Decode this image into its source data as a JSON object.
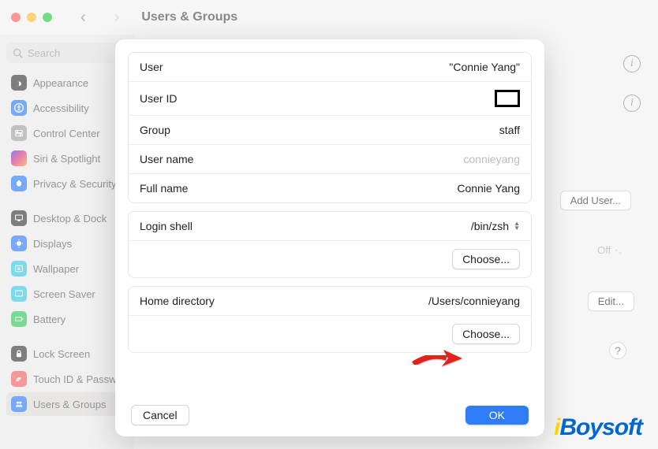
{
  "window": {
    "title": "Users & Groups"
  },
  "search": {
    "placeholder": "Search"
  },
  "sidebar": {
    "items": [
      {
        "label": "Appearance"
      },
      {
        "label": "Accessibility"
      },
      {
        "label": "Control Center"
      },
      {
        "label": "Siri & Spotlight"
      },
      {
        "label": "Privacy & Security"
      },
      {
        "label": "Desktop & Dock"
      },
      {
        "label": "Displays"
      },
      {
        "label": "Wallpaper"
      },
      {
        "label": "Screen Saver"
      },
      {
        "label": "Battery"
      },
      {
        "label": "Lock Screen"
      },
      {
        "label": "Touch ID & Password"
      },
      {
        "label": "Users & Groups"
      }
    ]
  },
  "content": {
    "add_user": "Add User...",
    "off": "Off",
    "edit": "Edit...",
    "help": "?"
  },
  "modal": {
    "row_user_label": "User",
    "row_user_value": "\"Connie Yang\"",
    "row_userid_label": "User ID",
    "row_group_label": "Group",
    "row_group_value": "staff",
    "row_username_label": "User name",
    "row_username_value": "connieyang",
    "row_fullname_label": "Full name",
    "row_fullname_value": "Connie Yang",
    "row_loginshell_label": "Login shell",
    "row_loginshell_value": "/bin/zsh",
    "row_homedir_label": "Home directory",
    "row_homedir_value": "/Users/connieyang",
    "choose_label": "Choose...",
    "cancel": "Cancel",
    "ok": "OK"
  },
  "watermark": {
    "text_pre": "i",
    "text_main": "Boysoft"
  }
}
